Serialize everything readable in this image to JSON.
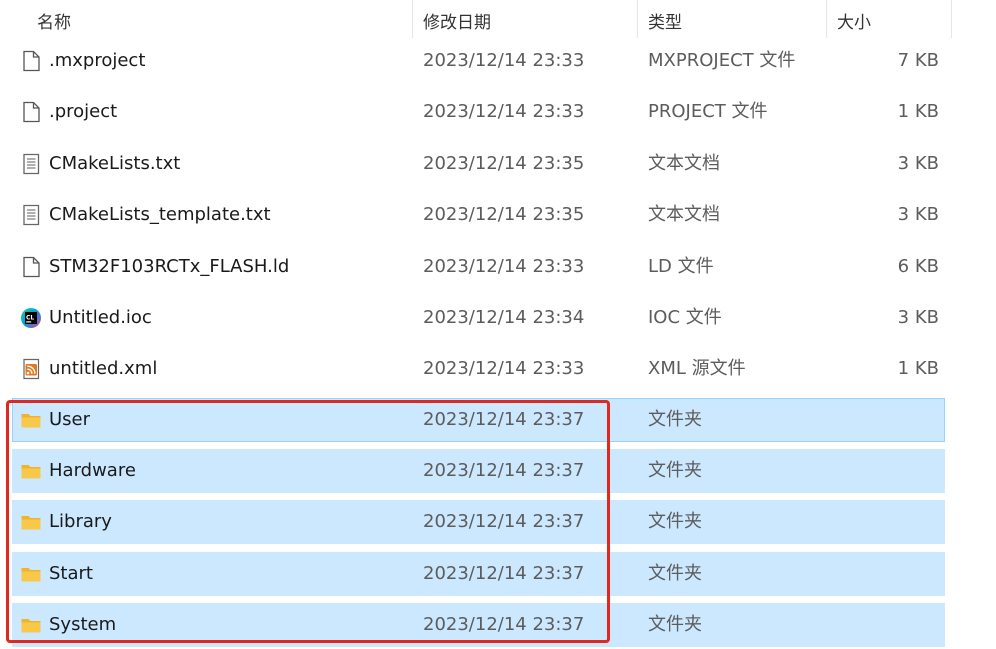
{
  "header": {
    "name": "名称",
    "date": "修改日期",
    "type": "类型",
    "size": "大小",
    "sort_indicator": "^"
  },
  "rows": [
    {
      "name": ".mxproject",
      "date": "2023/12/14 23:33",
      "type": "MXPROJECT 文件",
      "size": "7 KB",
      "icon": "blank-file-icon"
    },
    {
      "name": ".project",
      "date": "2023/12/14 23:33",
      "type": "PROJECT 文件",
      "size": "1 KB",
      "icon": "blank-file-icon"
    },
    {
      "name": "CMakeLists.txt",
      "date": "2023/12/14 23:35",
      "type": "文本文档",
      "size": "3 KB",
      "icon": "text-document-icon"
    },
    {
      "name": "CMakeLists_template.txt",
      "date": "2023/12/14 23:35",
      "type": "文本文档",
      "size": "3 KB",
      "icon": "text-document-icon"
    },
    {
      "name": "STM32F103RCTx_FLASH.ld",
      "date": "2023/12/14 23:33",
      "type": "LD 文件",
      "size": "6 KB",
      "icon": "blank-file-icon"
    },
    {
      "name": "Untitled.ioc",
      "date": "2023/12/14 23:34",
      "type": "IOC 文件",
      "size": "3 KB",
      "icon": "clion-app-icon"
    },
    {
      "name": "untitled.xml",
      "date": "2023/12/14 23:33",
      "type": "XML 源文件",
      "size": "1 KB",
      "icon": "rss-xml-icon"
    },
    {
      "name": "User",
      "date": "2023/12/14 23:37",
      "type": "文件夹",
      "size": "",
      "icon": "folder-icon"
    },
    {
      "name": "Hardware",
      "date": "2023/12/14 23:37",
      "type": "文件夹",
      "size": "",
      "icon": "folder-icon"
    },
    {
      "name": "Library",
      "date": "2023/12/14 23:37",
      "type": "文件夹",
      "size": "",
      "icon": "folder-icon"
    },
    {
      "name": "Start",
      "date": "2023/12/14 23:37",
      "type": "文件夹",
      "size": "",
      "icon": "folder-icon"
    },
    {
      "name": "System",
      "date": "2023/12/14 23:37",
      "type": "文件夹",
      "size": "",
      "icon": "folder-icon"
    }
  ],
  "colors": {
    "selection": "#cce8ff",
    "highlight_border": "#e0281f",
    "folder": "#f8c84a"
  }
}
